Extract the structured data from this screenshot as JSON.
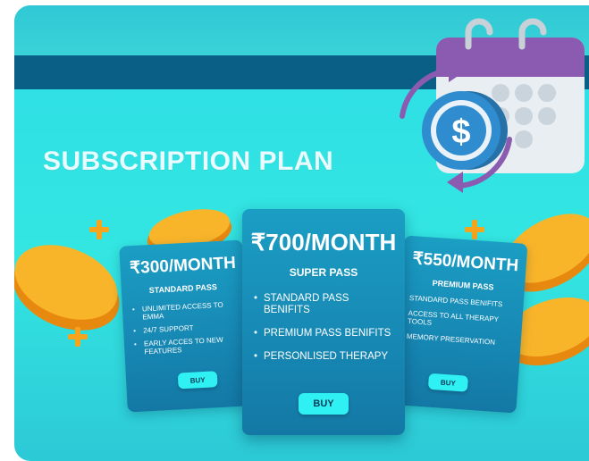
{
  "heading": "SUBSCRIPTION PLAN",
  "colors": {
    "background": "#33e6e2",
    "band": "#0a5f86",
    "card": "#1789b5",
    "button": "#2ff0f2",
    "coin": "#f7a41c",
    "calendar_header": "#8a5bb0",
    "dollar_coin": "#2f8ccf"
  },
  "icons": [
    "calendar-icon",
    "dollar-coin-icon",
    "cycle-arrows-icon",
    "gold-coin-icon",
    "plus-icon"
  ],
  "plans": [
    {
      "price": "₹300/MONTH",
      "name": "STANDARD PASS",
      "features": [
        "UNLIMITED ACCESS TO EMMA",
        "24/7 SUPPORT",
        "EARLY ACCES TO NEW FEATURES"
      ],
      "buy_label": "BUY"
    },
    {
      "price": "₹700/MONTH",
      "name": "SUPER PASS",
      "features": [
        "STANDARD PASS BENIFITS",
        "PREMIUM PASS BENIFITS",
        "PERSONLISED THERAPY"
      ],
      "buy_label": "BUY"
    },
    {
      "price": "₹550/MONTH",
      "name": "PREMIUM PASS",
      "features": [
        "STANDARD PASS BENIFITS",
        "ACCESS TO ALL THERAPY TOOLS",
        "MEMORY PRESERVATION"
      ],
      "buy_label": "BUY"
    }
  ]
}
